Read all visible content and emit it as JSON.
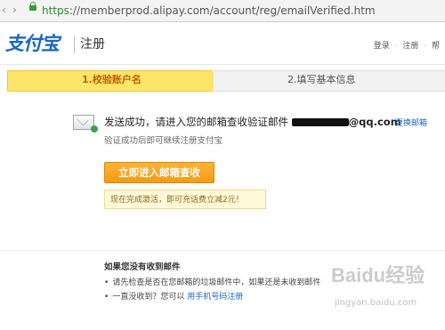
{
  "browser": {
    "url_scheme": "https",
    "url_rest": "://memberprod.alipay.com/account/reg/emailVerified.htm",
    "back_icon": "back-arrow-icon",
    "forward_icon": "forward-arrow-icon",
    "lock_icon": "lock-icon"
  },
  "header": {
    "logo_text": "支付宝",
    "title": "注册",
    "links": [
      "登录",
      "注册",
      "帮"
    ]
  },
  "steps": [
    {
      "label": "1.校验账户名",
      "active": true
    },
    {
      "label": "2.填写基本信息",
      "active": false
    }
  ],
  "main": {
    "message_prefix": "发送成功，请进入您的邮箱查收验证邮件",
    "email_suffix": "@qq.com",
    "change_email": "更换邮箱",
    "sub_message": "验证成功后即可继续注册支付宝",
    "cta_label": "立即进入邮箱查收",
    "tip": "现在完成激活，即可充话费立减2元！"
  },
  "help": {
    "title": "如果您没有收到邮件",
    "item1": "请先检查是否在您邮箱的垃圾邮件中，如果还是未收到邮件",
    "item2_prefix": "一直没收到？您可以",
    "item2_link": "用手机号码注册",
    "bullet": "•"
  },
  "watermark": {
    "text": "Baidu经验",
    "sub": "jingyan.baidu.com"
  },
  "colors": {
    "brand_blue": "#1a66c2",
    "step_active": "#fde56a",
    "cta_orange": "#f59a12"
  }
}
